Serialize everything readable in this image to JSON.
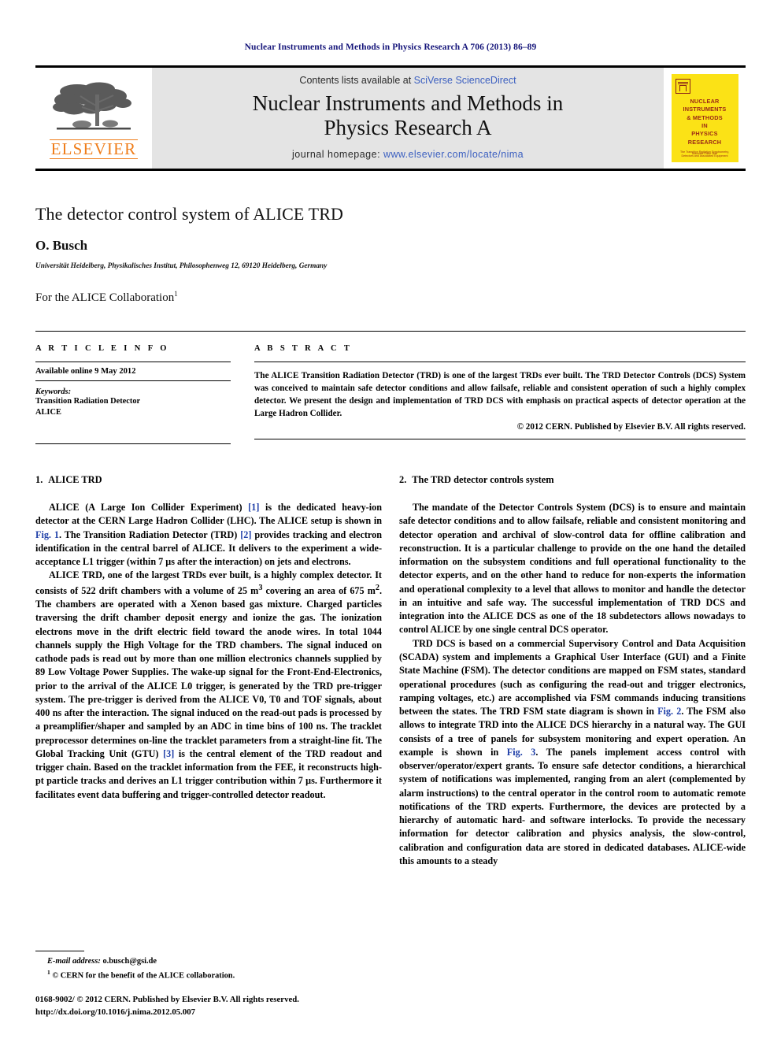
{
  "running_head": "Nuclear Instruments and Methods in Physics Research A 706 (2013) 86–89",
  "masthead": {
    "publisher_wordmark": "ELSEVIER",
    "contents_prefix": "Contents lists available at ",
    "contents_link": "SciVerse ScienceDirect",
    "journal_title_line1": "Nuclear Instruments and Methods in",
    "journal_title_line2": "Physics Research A",
    "homepage_prefix": "journal homepage: ",
    "homepage_link": "www.elsevier.com/locate/nima",
    "cover": {
      "title_lines": [
        "NUCLEAR",
        "INSTRUMENTS",
        "& METHODS",
        "IN",
        "PHYSICS",
        "RESEARCH"
      ],
      "subtitle": "The Transition Radiation Spectrometry, Detectors and Associated Equipment",
      "footer": "Associate Editor Staff"
    },
    "colors": {
      "banner_bg": "#e4e4e4",
      "link_blue": "#3b5fc0",
      "elsevier_orange": "#ef7d1a",
      "cover_yellow": "#fbe216",
      "cover_text": "#9c2a16",
      "running_head_blue": "#15157a"
    }
  },
  "article": {
    "title": "The detector control system of ALICE TRD",
    "author": "O. Busch",
    "affiliation": "Universität Heidelberg, Physikalisches Institut, Philosophenweg 12, 69120 Heidelberg, Germany",
    "collaboration": "For the ALICE Collaboration",
    "collaboration_marker": "1"
  },
  "article_info": {
    "heading": "A R T I C L E   I N F O",
    "available_online": "Available online 9 May 2012",
    "keywords_label": "Keywords:",
    "keywords": [
      "Transition Radiation Detector",
      "ALICE"
    ]
  },
  "abstract": {
    "heading": "A B S T R A C T",
    "text": "The ALICE Transition Radiation Detector (TRD) is one of the largest TRDs ever built. The TRD Detector Controls (DCS) System was conceived to maintain safe detector conditions and allow failsafe, reliable and consistent operation of such a highly complex detector. We present the design and implementation of TRD DCS with emphasis on practical aspects of detector operation at the Large Hadron Collider.",
    "copyright": "© 2012 CERN. Published by Elsevier B.V. All rights reserved."
  },
  "sections": {
    "left": {
      "number": "1.",
      "heading": "ALICE TRD",
      "para1_a": "ALICE (A Large Ion Collider Experiment) ",
      "para1_ref1": "[1]",
      "para1_b": " is the dedicated heavy-ion detector at the CERN Large Hadron Collider (LHC). The ALICE setup is shown in ",
      "para1_fig1": "Fig. 1",
      "para1_c": ". The Transition Radiation Detector (TRD) ",
      "para1_ref2": "[2]",
      "para1_d": " provides tracking and electron identification in the central barrel of ALICE. It delivers to the experiment a wide-acceptance L1 trigger (within 7 μs after the interaction) on jets and electrons.",
      "para2_a": "ALICE TRD, one of the largest TRDs ever built, is a highly complex detector. It consists of 522 drift chambers with a volume of 25 m",
      "para2_sup1": "3",
      "para2_b": " covering an area of 675 m",
      "para2_sup2": "2",
      "para2_c": ". The chambers are operated with a Xenon based gas mixture. Charged particles traversing the drift chamber deposit energy and ionize the gas. The ionization electrons move in the drift electric field toward the anode wires. In total 1044 channels supply the High Voltage for the TRD chambers. The signal induced on cathode pads is read out by more than one million electronics channels supplied by 89 Low Voltage Power Supplies. The wake-up signal for the Front-End-Electronics, prior to the arrival of the ALICE L0 trigger, is generated by the TRD pre-trigger system. The pre-trigger is derived from the ALICE V0, T0 and TOF signals, about 400 ns after the interaction. The signal induced on the read-out pads is processed by a preamplifier/shaper and sampled by an ADC in time bins of 100 ns. The tracklet preprocessor determines on-line the tracklet parameters from a straight-line fit. The Global Tracking Unit (GTU) ",
      "para2_ref3": "[3]",
      "para2_d": " is the central element of the TRD readout and trigger chain. Based on the tracklet information from the FEE, it reconstructs high-pt particle tracks and derives an L1 trigger contribution within 7 μs. Furthermore it facilitates event data buffering and trigger-controlled detector readout."
    },
    "right": {
      "number": "2.",
      "heading": "The TRD detector controls system",
      "para1": "The mandate of the Detector Controls System (DCS) is to ensure and maintain safe detector conditions and to allow failsafe, reliable and consistent monitoring and detector operation and archival of slow-control data for offline calibration and reconstruction. It is a particular challenge to provide on the one hand the detailed information on the subsystem conditions and full operational functionality to the detector experts, and on the other hand to reduce for non-experts the information and operational complexity to a level that allows to monitor and handle the detector in an intuitive and safe way. The successful implementation of TRD DCS and integration into the ALICE DCS as one of the 18 subdetectors allows nowadays to control ALICE by one single central DCS operator.",
      "para2_a": "TRD DCS is based on a commercial Supervisory Control and Data Acquisition (SCADA) system and implements a Graphical User Interface (GUI) and a Finite State Machine (FSM). The detector conditions are mapped on FSM states, standard operational procedures (such as configuring the read-out and trigger electronics, ramping voltages, etc.) are accomplished via FSM commands inducing transitions between the states. The TRD FSM state diagram is shown in ",
      "para2_fig2": "Fig. 2",
      "para2_b": ". The FSM also allows to integrate TRD into the ALICE DCS hierarchy in a natural way. The GUI consists of a tree of panels for subsystem monitoring and expert operation. An example is shown in ",
      "para2_fig3": "Fig. 3",
      "para2_c": ". The panels implement access control with observer/operator/expert grants. To ensure safe detector conditions, a hierarchical system of notifications was implemented, ranging from an alert (complemented by alarm instructions) to the central operator in the control room to automatic remote notifications of the TRD experts. Furthermore, the devices are protected by a hierarchy of automatic hard- and software interlocks. To provide the necessary information for detector calibration and physics analysis, the slow-control, calibration and configuration data are stored in dedicated databases. ALICE-wide this amounts to a steady"
    }
  },
  "footnotes": {
    "email_label": "E-mail address:",
    "email": "o.busch@gsi.de",
    "note_marker": "1",
    "note_text": "© CERN for the benefit of the ALICE collaboration."
  },
  "footer": {
    "issn_line": "0168-9002/ © 2012 CERN. Published by Elsevier B.V. All rights reserved.",
    "doi_line": "http://dx.doi.org/10.1016/j.nima.2012.05.007"
  }
}
